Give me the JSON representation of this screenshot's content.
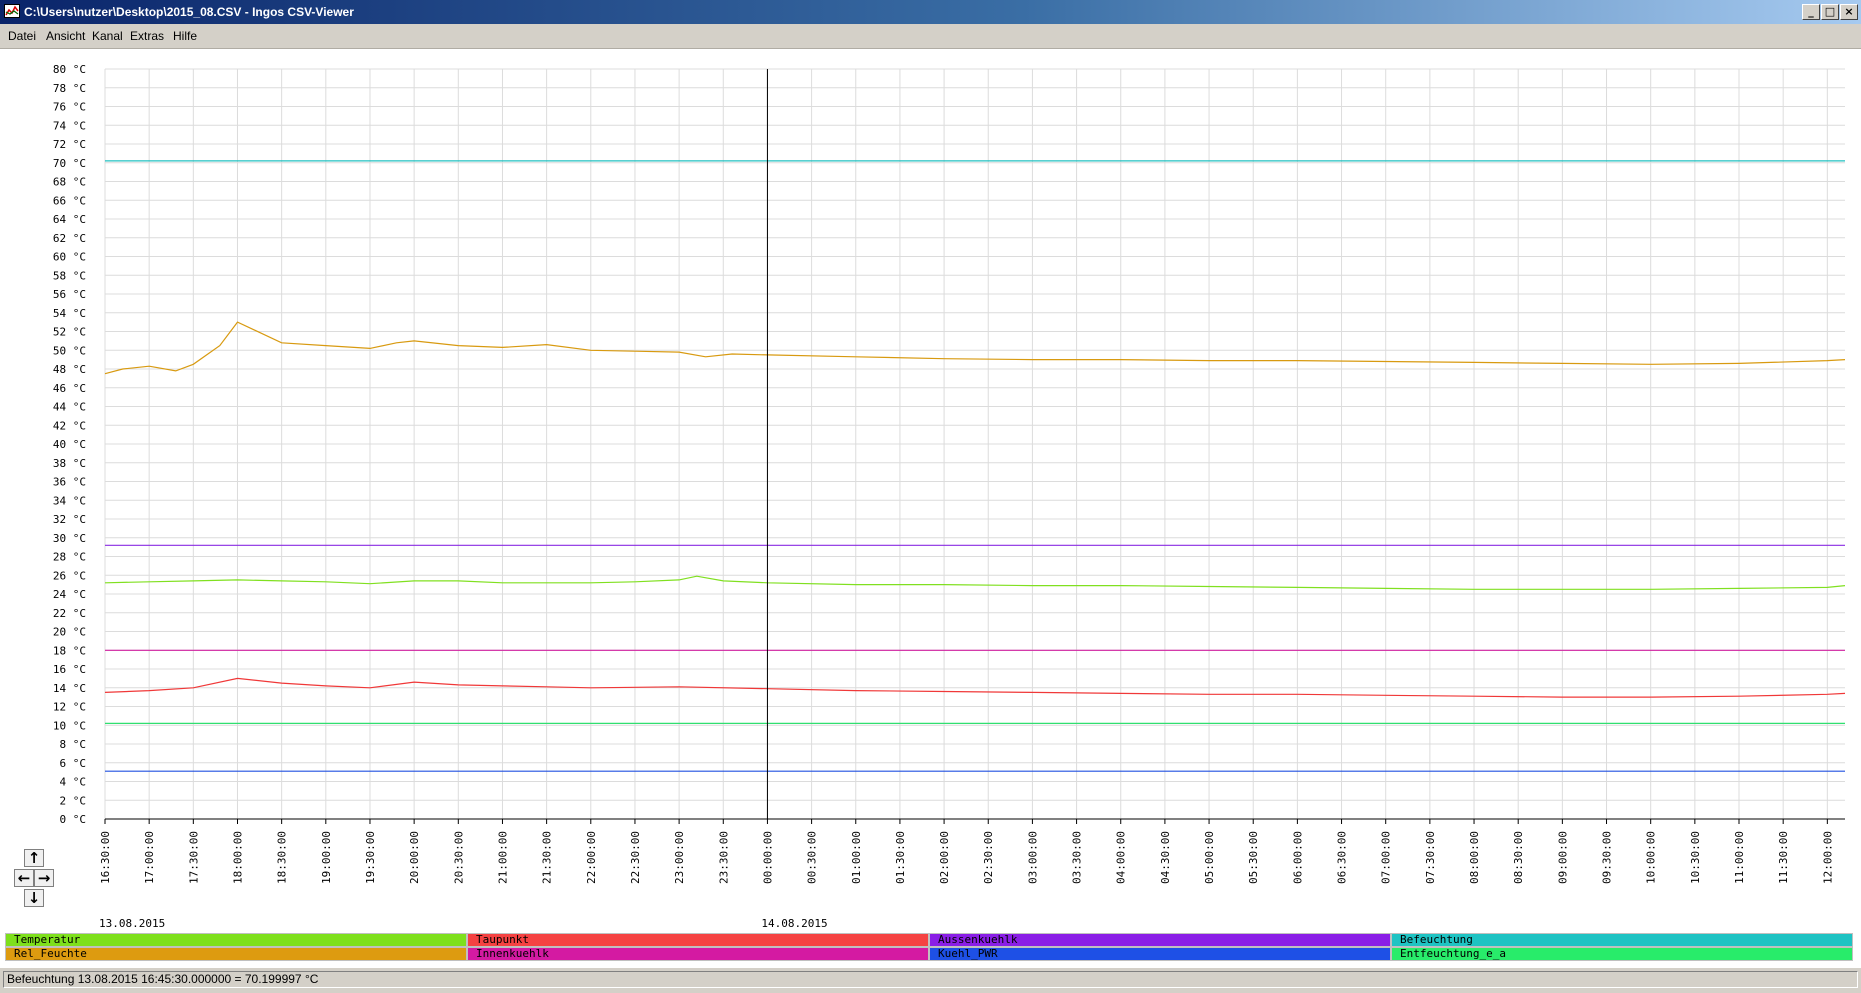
{
  "window": {
    "title": "C:\\Users\\nutzer\\Desktop\\2015_08.CSV - Ingos CSV-Viewer",
    "minimize": "_",
    "maximize": "□",
    "close": "×"
  },
  "menu": [
    "Datei",
    "Ansicht",
    "Kanal",
    "Extras",
    "Hilfe"
  ],
  "chart_data": {
    "type": "line",
    "y_unit": "°C",
    "ylim": [
      0,
      80
    ],
    "y_ticks": [
      80,
      78,
      76,
      74,
      72,
      70,
      68,
      66,
      64,
      62,
      60,
      58,
      56,
      54,
      52,
      50,
      48,
      46,
      44,
      42,
      40,
      38,
      36,
      34,
      32,
      30,
      28,
      26,
      24,
      22,
      20,
      18,
      16,
      14,
      12,
      10,
      8,
      6,
      4,
      2,
      0
    ],
    "y_tick_suffix": " °C",
    "x_start_hours": 16.5,
    "x_end_hours": 36.2,
    "x_ticks": [
      "16:30:00",
      "17:00:00",
      "17:30:00",
      "18:00:00",
      "18:30:00",
      "19:00:00",
      "19:30:00",
      "20:00:00",
      "20:30:00",
      "21:00:00",
      "21:30:00",
      "22:00:00",
      "22:30:00",
      "23:00:00",
      "23:30:00",
      "00:00:00",
      "00:30:00",
      "01:00:00",
      "01:30:00",
      "02:00:00",
      "02:30:00",
      "03:00:00",
      "03:30:00",
      "04:00:00",
      "04:30:00",
      "05:00:00",
      "05:30:00",
      "06:00:00",
      "06:30:00",
      "07:00:00",
      "07:30:00",
      "08:00:00",
      "08:30:00",
      "09:00:00",
      "09:30:00",
      "10:00:00",
      "10:30:00",
      "11:00:00",
      "11:30:00",
      "12:00:00"
    ],
    "date_labels": [
      "13.08.2015",
      "14.08.2015"
    ],
    "cursor_time": "00:00:00",
    "grid": true,
    "series": [
      {
        "name": "Temperatur",
        "color": "#80e020",
        "x": [
          16.5,
          17,
          17.5,
          18,
          18.5,
          19,
          19.5,
          20,
          20.5,
          21,
          21.5,
          22,
          22.5,
          23,
          23.2,
          23.5,
          24,
          25,
          26,
          27,
          28,
          29,
          30,
          31,
          32,
          33,
          34,
          35,
          36,
          36.2
        ],
        "y": [
          25.2,
          25.3,
          25.4,
          25.5,
          25.4,
          25.3,
          25.1,
          25.4,
          25.4,
          25.2,
          25.2,
          25.2,
          25.3,
          25.5,
          25.9,
          25.4,
          25.2,
          25.0,
          25.0,
          24.9,
          24.9,
          24.8,
          24.7,
          24.6,
          24.5,
          24.5,
          24.5,
          24.6,
          24.7,
          24.9
        ]
      },
      {
        "name": "Taupunkt",
        "color": "#f03838",
        "x": [
          16.5,
          17,
          17.5,
          18,
          18.5,
          19,
          19.5,
          20,
          20.5,
          21,
          21.5,
          22,
          23,
          24,
          25,
          26,
          27,
          28,
          29,
          30,
          31,
          32,
          33,
          34,
          35,
          36,
          36.2
        ],
        "y": [
          13.5,
          13.7,
          14.0,
          15.0,
          14.5,
          14.2,
          14.0,
          14.6,
          14.3,
          14.2,
          14.1,
          14.0,
          14.1,
          13.9,
          13.7,
          13.6,
          13.5,
          13.4,
          13.3,
          13.3,
          13.2,
          13.1,
          13.0,
          13.0,
          13.1,
          13.3,
          13.4
        ]
      },
      {
        "name": "Aussenkuehlk",
        "color": "#8a2be2",
        "x": [
          16.5,
          36.2
        ],
        "y": [
          29.2,
          29.2
        ]
      },
      {
        "name": "Befeuchtung",
        "color": "#20c0c0",
        "x": [
          16.5,
          36.2
        ],
        "y": [
          70.2,
          70.2
        ]
      },
      {
        "name": "Rel_Feuchte",
        "color": "#d89a10",
        "x": [
          16.5,
          16.7,
          17,
          17.3,
          17.5,
          17.8,
          18,
          18.5,
          19,
          19.5,
          19.8,
          20,
          20.5,
          21,
          21.5,
          22,
          22.5,
          23,
          23.3,
          23.6,
          24,
          25,
          26,
          27,
          28,
          29,
          30,
          31,
          32,
          33,
          34,
          35,
          36,
          36.2
        ],
        "y": [
          47.5,
          48.0,
          48.3,
          47.8,
          48.5,
          50.5,
          53.0,
          50.8,
          50.5,
          50.2,
          50.8,
          51.0,
          50.5,
          50.3,
          50.6,
          50.0,
          49.9,
          49.8,
          49.3,
          49.6,
          49.5,
          49.3,
          49.1,
          49.0,
          49.0,
          48.9,
          48.9,
          48.8,
          48.7,
          48.6,
          48.5,
          48.6,
          48.9,
          49.0
        ]
      },
      {
        "name": "Innenkuehlk",
        "color": "#d020a0",
        "x": [
          16.5,
          36.2
        ],
        "y": [
          18.0,
          18.0
        ]
      },
      {
        "name": "Kuehl_PWR",
        "color": "#2050e0",
        "x": [
          16.5,
          36.2
        ],
        "y": [
          5.1,
          5.1
        ]
      },
      {
        "name": "Entfeuchtung_e_a",
        "color": "#30e070",
        "x": [
          16.5,
          36.2
        ],
        "y": [
          10.2,
          10.2
        ]
      }
    ]
  },
  "legend_colors": [
    "#7ee01c",
    "#f54242",
    "#8a1ee6",
    "#1ec3c3",
    "#dd9b10",
    "#d41aa2",
    "#1e50e6",
    "#28ec6a"
  ],
  "nav": {
    "up": "↑",
    "left": "←",
    "right": "→",
    "down": "↓"
  },
  "status": "Befeuchtung 13.08.2015 16:45:30.000000 = 70.199997 °C"
}
